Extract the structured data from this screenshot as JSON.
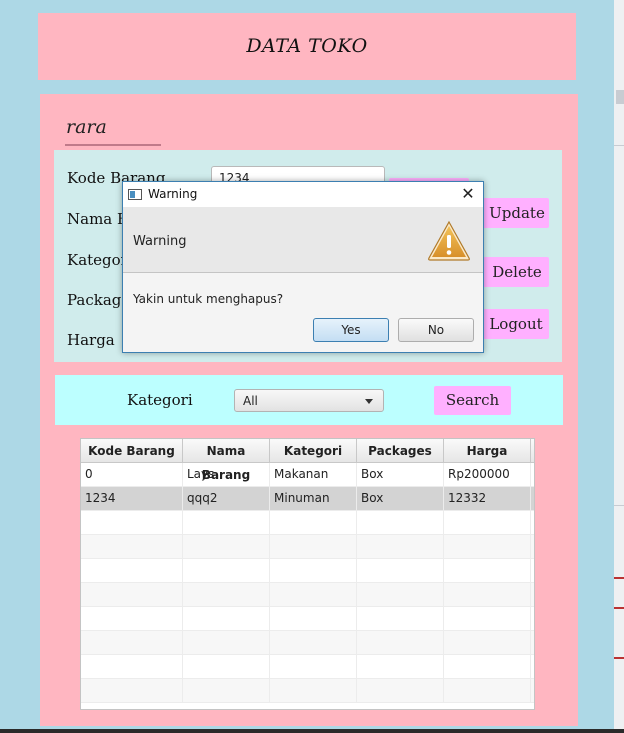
{
  "header": {
    "title": "DATA TOKO"
  },
  "user": {
    "name": "rara"
  },
  "form": {
    "kode_label": "Kode Barang",
    "nama_label": "Nama Ba",
    "kategori_label": "Kategor",
    "packages_label": "Package",
    "harga_label": "Harga",
    "kode_value": "1234",
    "update_label": "Update",
    "delete_label": "Delete",
    "logout_label": "Logout"
  },
  "filter": {
    "kategori_label": "Kategori",
    "selected": "All",
    "search_label": "Search"
  },
  "table": {
    "headers": [
      "Kode Barang",
      "Nama Barang",
      "Kategori",
      "Packages",
      "Harga"
    ],
    "rows": [
      [
        "0",
        "Lays",
        "Makanan",
        "Box",
        "Rp200000"
      ],
      [
        "1234",
        "qqq2",
        "Minuman",
        "Box",
        "12332"
      ]
    ],
    "selected_row": 1
  },
  "dialog": {
    "title": "Warning",
    "header": "Warning",
    "message": "Yakin untuk menghapus?",
    "yes_label": "Yes",
    "no_label": "No",
    "icon": "warning-triangle-icon"
  },
  "colors": {
    "window_bg": "#add8e6",
    "panel_pink": "#ffb6c1",
    "form_bg": "#d0ecec",
    "search_bg": "#bcffff",
    "button_pink": "#ffb0ff",
    "warning_icon": "#e0a330"
  }
}
